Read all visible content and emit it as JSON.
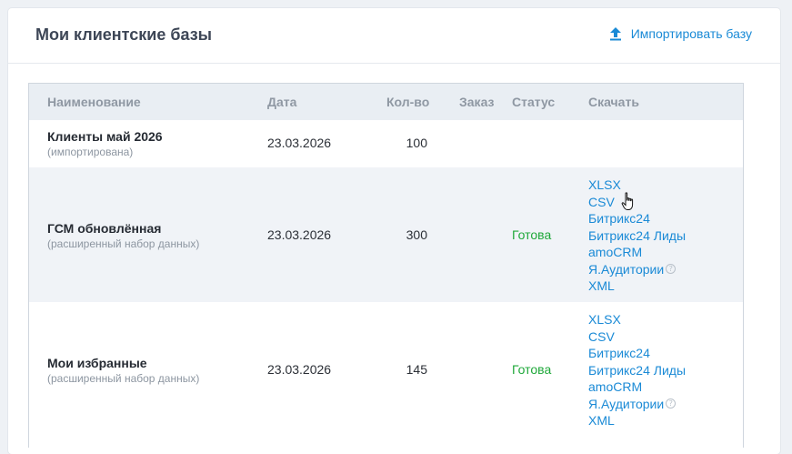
{
  "header": {
    "title": "Мои клиентские базы",
    "import_label": "Импортировать базу",
    "import_icon": "upload-icon"
  },
  "table": {
    "columns": [
      "Наименование",
      "Дата",
      "Кол-во",
      "Заказ",
      "Статус",
      "Скачать"
    ],
    "rows": [
      {
        "name": "Клиенты май 2026",
        "subtitle": "(импортирована)",
        "date": "23.03.2026",
        "qty": "100",
        "order": "",
        "status": "",
        "downloads": []
      },
      {
        "name": "ГСМ обновлённая",
        "subtitle": "(расширенный набор данных)",
        "date": "23.03.2026",
        "qty": "300",
        "order": "",
        "status": "Готова",
        "downloads": [
          "XLSX",
          "CSV",
          "Битрикс24",
          "Битрикс24 Лиды",
          "amoCRM",
          "Я.Аудитории",
          "XML"
        ]
      },
      {
        "name": "Мои избранные",
        "subtitle": "(расширенный набор данных)",
        "date": "23.03.2026",
        "qty": "145",
        "order": "",
        "status": "Готова",
        "downloads": [
          "XLSX",
          "CSV",
          "Битрикс24",
          "Битрикс24 Лиды",
          "amoCRM",
          "Я.Аудитории",
          "XML"
        ]
      }
    ]
  },
  "colors": {
    "accent": "#1a8ad6",
    "status_ready": "#1fa83a",
    "header_bg": "#e9eef3",
    "alt_row_bg": "#f0f3f7"
  }
}
